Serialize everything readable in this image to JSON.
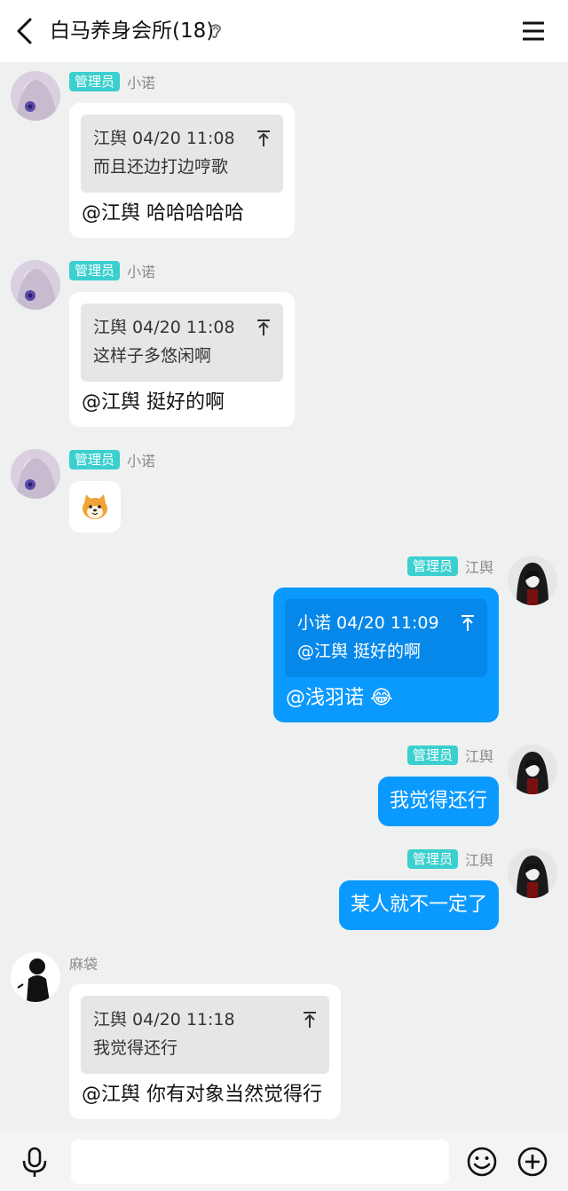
{
  "header": {
    "title": "白马养身会所(18)"
  },
  "messages": [
    {
      "sender": "小诺",
      "role_badge": "管理员",
      "quote": {
        "author_time": "江舆 04/20 11:08",
        "text": "而且还边打边哼歌"
      },
      "text": "@江舆 哈哈哈哈哈"
    },
    {
      "sender": "小诺",
      "role_badge": "管理员",
      "quote": {
        "author_time": "江舆 04/20 11:08",
        "text": "这样子多悠闲啊"
      },
      "text": "@江舆 挺好的啊"
    },
    {
      "sender": "小诺",
      "role_badge": "管理员",
      "sticker": "shiba-dog-face"
    },
    {
      "sender": "江舆",
      "role_badge": "管理员",
      "quote": {
        "author_time": "小诺 04/20 11:09",
        "text": "@江舆 挺好的啊"
      },
      "text": "@浅羽诺 😂"
    },
    {
      "sender": "江舆",
      "role_badge": "管理员",
      "text": "我觉得还行"
    },
    {
      "sender": "江舆",
      "role_badge": "管理员",
      "text": "某人就不一定了"
    },
    {
      "sender": "麻袋",
      "quote": {
        "author_time": "江舆 04/20 11:18",
        "text": "我觉得还行"
      },
      "text": "@江舆 你有对象当然觉得行"
    }
  ],
  "input": {
    "placeholder": ""
  },
  "colors": {
    "outgoing_bubble": "#0a99ff",
    "badge": "#3ccfcf",
    "background": "#eef1ef"
  }
}
